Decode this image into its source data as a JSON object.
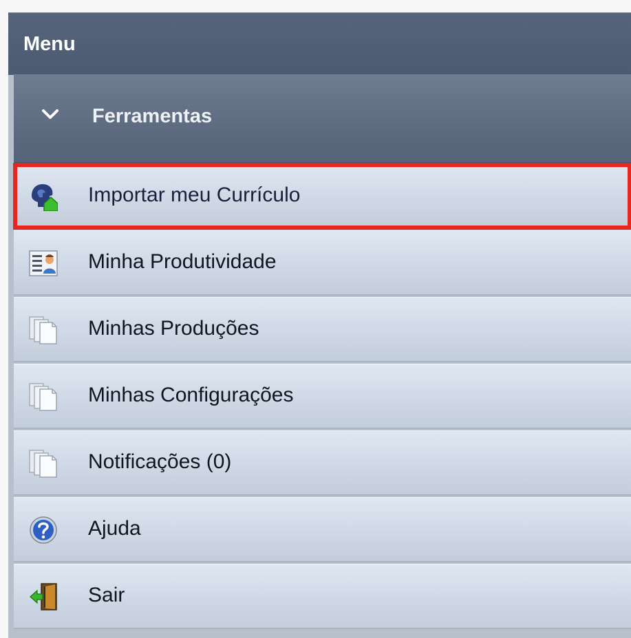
{
  "menu": {
    "title": "Menu"
  },
  "section": {
    "label": "Ferramentas",
    "icon": "chevron-down-icon",
    "expanded": true
  },
  "items": [
    {
      "label": "Importar meu Currículo",
      "icon": "import-curriculum-icon",
      "highlighted": true,
      "highlight_color": "#e8261f"
    },
    {
      "label": "Minha Produtividade",
      "icon": "productivity-report-icon"
    },
    {
      "label": "Minhas Produções",
      "icon": "documents-icon"
    },
    {
      "label": "Minhas Configurações",
      "icon": "documents-icon"
    },
    {
      "label": "Notificações (0)",
      "icon": "documents-icon"
    },
    {
      "label": "Ajuda",
      "icon": "help-icon"
    },
    {
      "label": "Sair",
      "icon": "exit-door-icon"
    }
  ]
}
